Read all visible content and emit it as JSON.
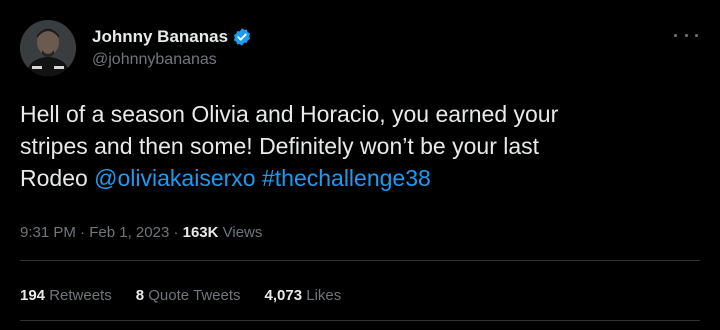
{
  "tweet": {
    "author": {
      "display_name": "Johnny Bananas",
      "handle": "@johnnybananas",
      "verified": true,
      "avatar_icon": "user-photo"
    },
    "text": {
      "line1": "Hell of a season Olivia and Horacio, you earned your",
      "line2": "stripes and then some! Definitely won’t be your last",
      "line3_prefix": "Rodeo ",
      "mention": "@oliviakaiserxo",
      "hashtag": "#thechallenge38"
    },
    "meta": {
      "time": "9:31 PM",
      "separator": " · ",
      "date": "Feb 1, 2023",
      "views_count": "163K",
      "views_label": " Views"
    },
    "stats": {
      "retweets_count": "194",
      "retweets_label": " Retweets",
      "quotes_count": "8",
      "quotes_label": " Quote Tweets",
      "likes_count": "4,073",
      "likes_label": " Likes"
    }
  },
  "colors": {
    "background": "#000000",
    "text_primary": "#e7e9ea",
    "text_secondary": "#71767b",
    "link": "#1d9bf0",
    "verified_badge": "#1d9bf0",
    "divider": "#2f3336"
  }
}
